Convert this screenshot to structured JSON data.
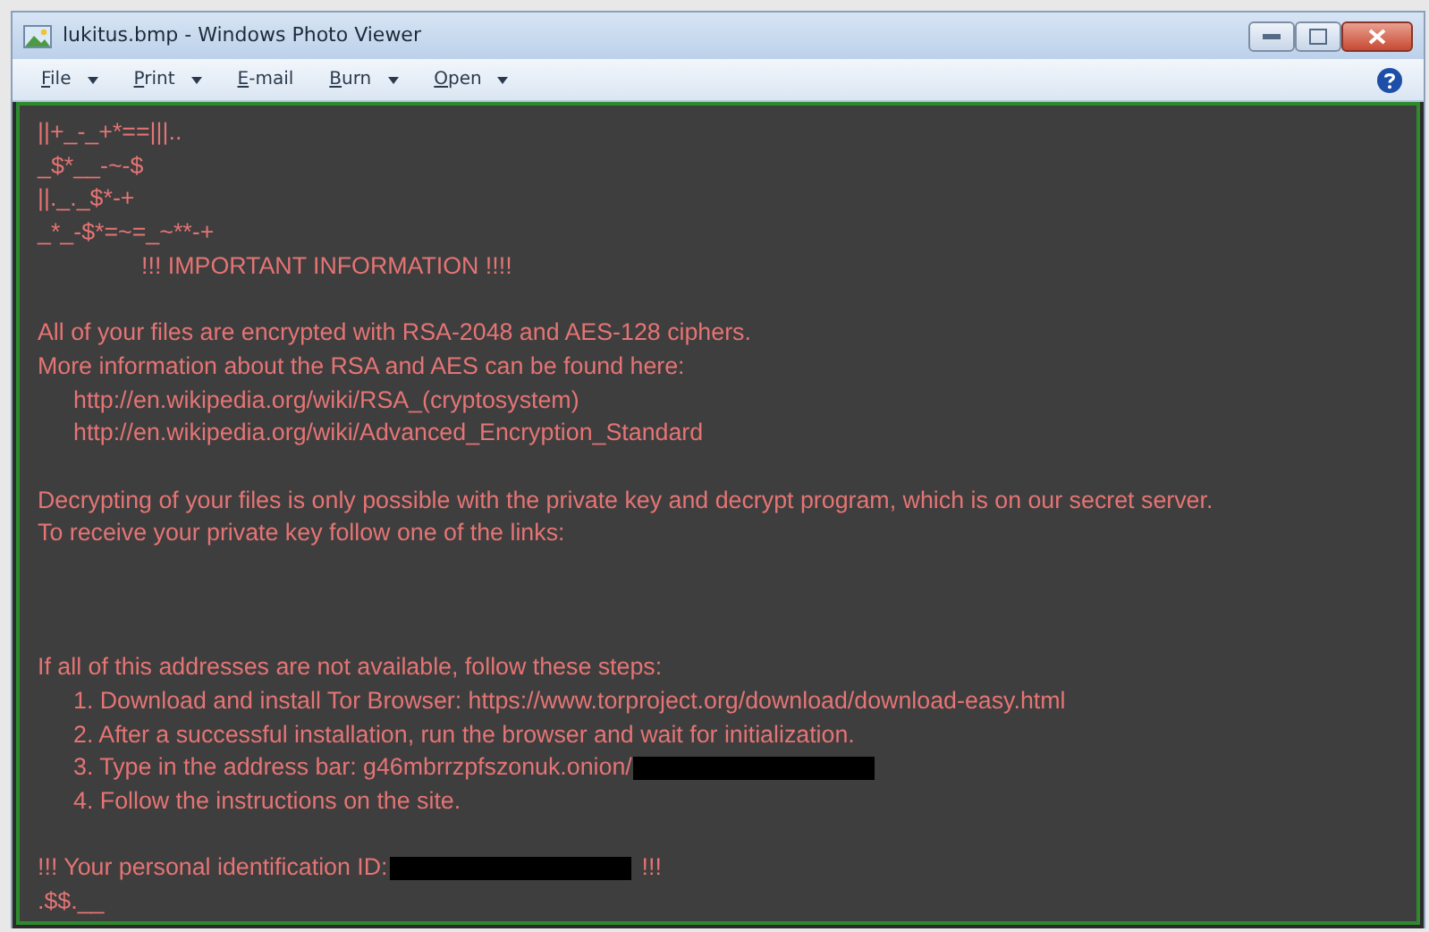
{
  "window": {
    "title": "lukitus.bmp - Windows Photo Viewer"
  },
  "menu": [
    {
      "label": "File",
      "dropdown": true
    },
    {
      "label": "Print",
      "dropdown": true
    },
    {
      "label": "E-mail",
      "dropdown": false
    },
    {
      "label": "Burn",
      "dropdown": true
    },
    {
      "label": "Open",
      "dropdown": true
    }
  ],
  "note": {
    "art": [
      "||+_-_+*==|||..",
      "_$*__-~-$",
      "||._._$*-+",
      "_*_-$*=~=_~**-+"
    ],
    "heading": "!!! IMPORTANT INFORMATION !!!!",
    "blocks": [
      {
        "lines": [
          {
            "text": "All of your files are encrypted with RSA-2048 and AES-128 ciphers.",
            "kind": "plain"
          },
          {
            "text": "More information about the RSA and AES can be found here:",
            "kind": "plain"
          },
          {
            "text": "http://en.wikipedia.org/wiki/RSA_(cryptosystem)",
            "kind": "indented"
          },
          {
            "text": "http://en.wikipedia.org/wiki/Advanced_Encryption_Standard",
            "kind": "indented"
          }
        ]
      },
      {
        "lines": [
          {
            "text": "Decrypting of your files is only possible with the private key and decrypt program, which is on our secret server.",
            "kind": "plain"
          },
          {
            "text": "To receive your private key follow one of the links:",
            "kind": "plain"
          }
        ]
      },
      {
        "lines": [
          {
            "text": "If all of this addresses are not available, follow these steps:",
            "kind": "plain"
          },
          {
            "text": "1. Download and install Tor Browser: https://www.torproject.org/download/download-easy.html",
            "kind": "indented"
          },
          {
            "text": "2. After a successful installation, run the browser and wait for initialization.",
            "kind": "indented"
          },
          {
            "text": "3. Type in the address bar: g46mbrrzpfszonuk.onion/",
            "kind": "indented",
            "redacted": true
          },
          {
            "text": "4. Follow the instructions on the site.",
            "kind": "indented"
          }
        ]
      },
      {
        "lines": [
          {
            "text": "!!! Your personal identification ID:",
            "kind": "plain",
            "redacted": true,
            "after": "!!!"
          },
          {
            "text": ".$$.__",
            "kind": "plain"
          }
        ]
      }
    ]
  }
}
